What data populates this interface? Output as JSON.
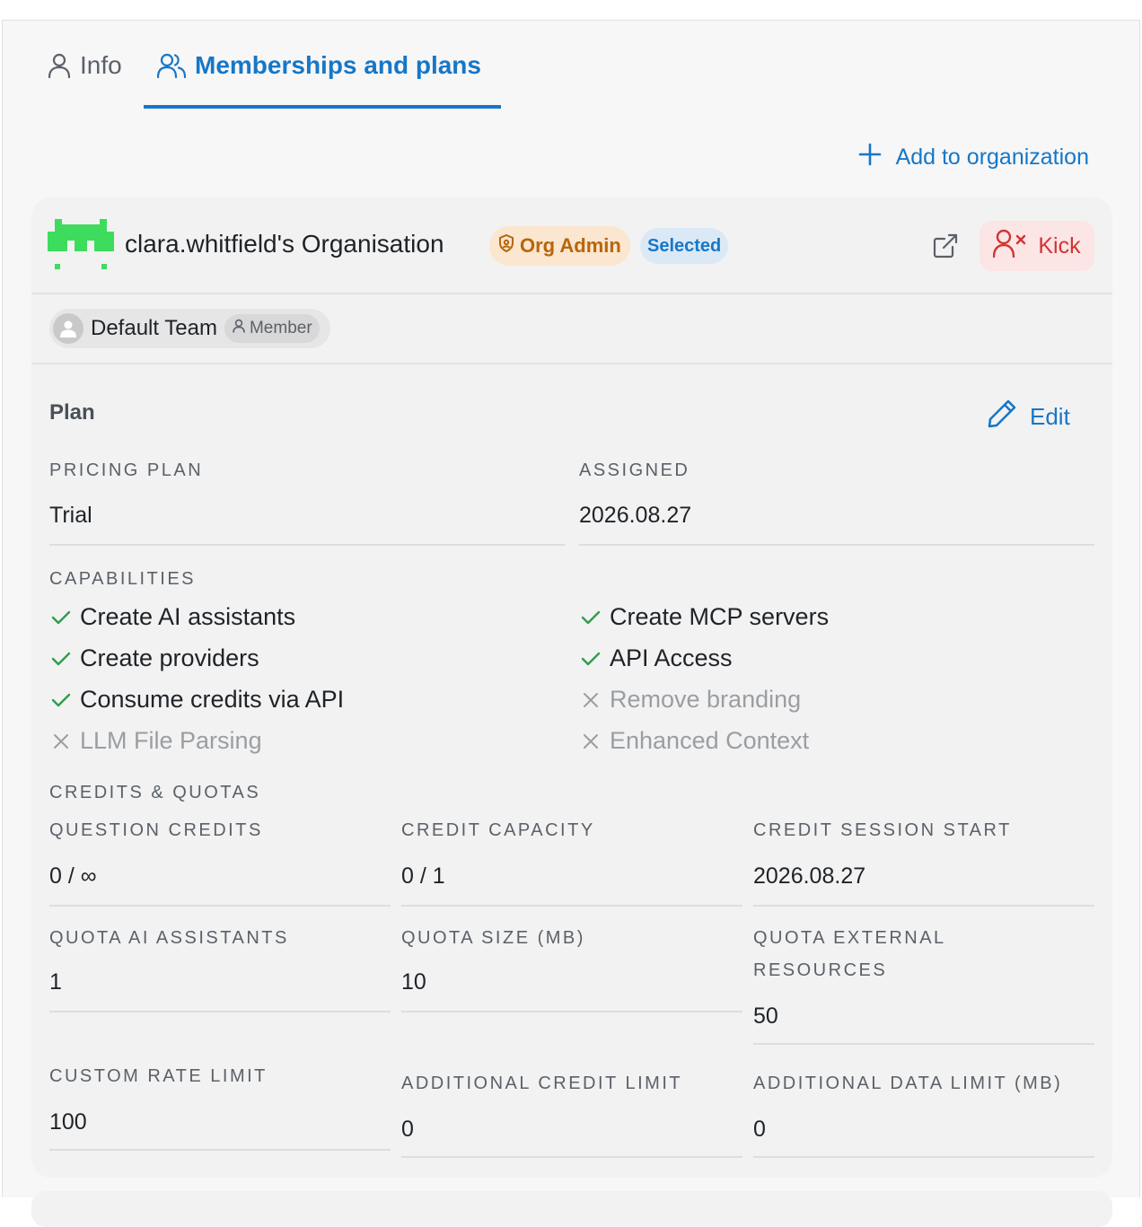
{
  "tabs": [
    {
      "label": "Info",
      "icon": "user-icon",
      "active": false
    },
    {
      "label": "Memberships and plans",
      "icon": "users-icon",
      "active": true
    }
  ],
  "actions": {
    "add_to_org": "Add to organization"
  },
  "org": {
    "name": "clara.whitfield's Organisation",
    "role_badge": "Org Admin",
    "selected_badge": "Selected",
    "kick_label": "Kick"
  },
  "team": {
    "name": "Default Team",
    "role": "Member"
  },
  "plan": {
    "title": "Plan",
    "edit_label": "Edit",
    "pricing_plan_label": "PRICING PLAN",
    "pricing_plan_value": "Trial",
    "assigned_label": "ASSIGNED",
    "assigned_value": "2026.08.27"
  },
  "capabilities": {
    "label": "CAPABILITIES",
    "left": [
      {
        "text": "Create AI assistants",
        "enabled": true
      },
      {
        "text": "Create providers",
        "enabled": true
      },
      {
        "text": "Consume credits via API",
        "enabled": true
      },
      {
        "text": "LLM File Parsing",
        "enabled": false
      }
    ],
    "right": [
      {
        "text": "Create MCP servers",
        "enabled": true
      },
      {
        "text": "API Access",
        "enabled": true
      },
      {
        "text": "Remove branding",
        "enabled": false
      },
      {
        "text": "Enhanced Context",
        "enabled": false
      }
    ]
  },
  "credits": {
    "label": "CREDITS & QUOTAS",
    "question_credits": {
      "label": "QUESTION CREDITS",
      "value": "0 / ∞"
    },
    "credit_capacity": {
      "label": "CREDIT CAPACITY",
      "value": "0 / 1"
    },
    "credit_session_start": {
      "label": "CREDIT SESSION START",
      "value": "2026.08.27"
    },
    "quota_ai_assistants": {
      "label": "QUOTA AI ASSISTANTS",
      "value": "1"
    },
    "quota_size": {
      "label": "QUOTA SIZE (MB)",
      "value": "10"
    },
    "quota_external_resources": {
      "label": "QUOTA EXTERNAL RESOURCES",
      "value": "50"
    },
    "custom_rate_limit": {
      "label": "CUSTOM RATE LIMIT",
      "value": "100"
    },
    "additional_credit_limit": {
      "label": "ADDITIONAL CREDIT LIMIT",
      "value": "0"
    },
    "additional_data_limit": {
      "label": "ADDITIONAL DATA LIMIT (MB)",
      "value": "0"
    }
  },
  "colors": {
    "accent": "#1677c7",
    "admin_badge_bg": "#fbe6cf",
    "admin_badge_text": "#b8650b",
    "kick_bg": "#fbe5e5",
    "kick_text": "#d23434",
    "check": "#2e9e4b",
    "logo": "#3ddc5c"
  }
}
